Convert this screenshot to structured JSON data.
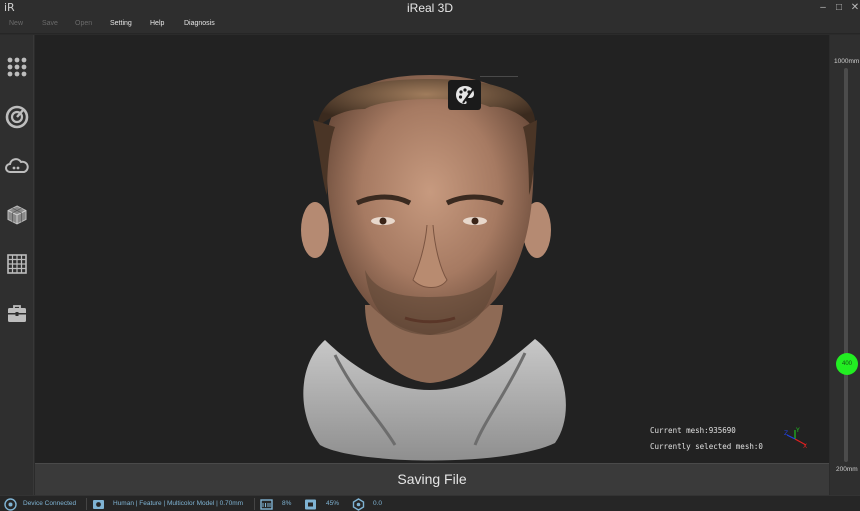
{
  "window": {
    "logo": "iR",
    "title": "iReal 3D",
    "minimize": "–",
    "maximize": "□",
    "close": "✕"
  },
  "menu": {
    "items": [
      {
        "label": "New",
        "enabled": false
      },
      {
        "label": "Save",
        "enabled": false
      },
      {
        "label": "Open",
        "enabled": false
      },
      {
        "label": "Setting",
        "enabled": true
      },
      {
        "label": "Help",
        "enabled": true
      },
      {
        "label": "Diagnosis",
        "enabled": true
      }
    ]
  },
  "toolbar": {
    "icons": [
      "grid-dots-icon",
      "power-refresh-icon",
      "cloud-icon",
      "mesh-cube-icon",
      "grid-square-icon",
      "toolbox-icon"
    ]
  },
  "viewport": {
    "palette_icon": "palette-icon",
    "current_mesh": "Current mesh:935690",
    "selected_mesh": "Currently selected mesh:0",
    "axis": {
      "x": "X",
      "y": "Y",
      "z": "Z"
    }
  },
  "status_strip": {
    "text": "Saving File"
  },
  "distance_slider": {
    "max_label": "1000mm",
    "min_label": "200mm",
    "value_label": "400",
    "value": 400,
    "min": 200,
    "max": 1000
  },
  "statusbar": {
    "device": "Device Connected",
    "mode": "Human | Feature | Multicolor Model | 0.70mm",
    "memory": "8%",
    "usage": "45%",
    "fps": "0.0"
  },
  "colors": {
    "accent_green": "#22ee22",
    "status_text": "#7fb3d3"
  }
}
